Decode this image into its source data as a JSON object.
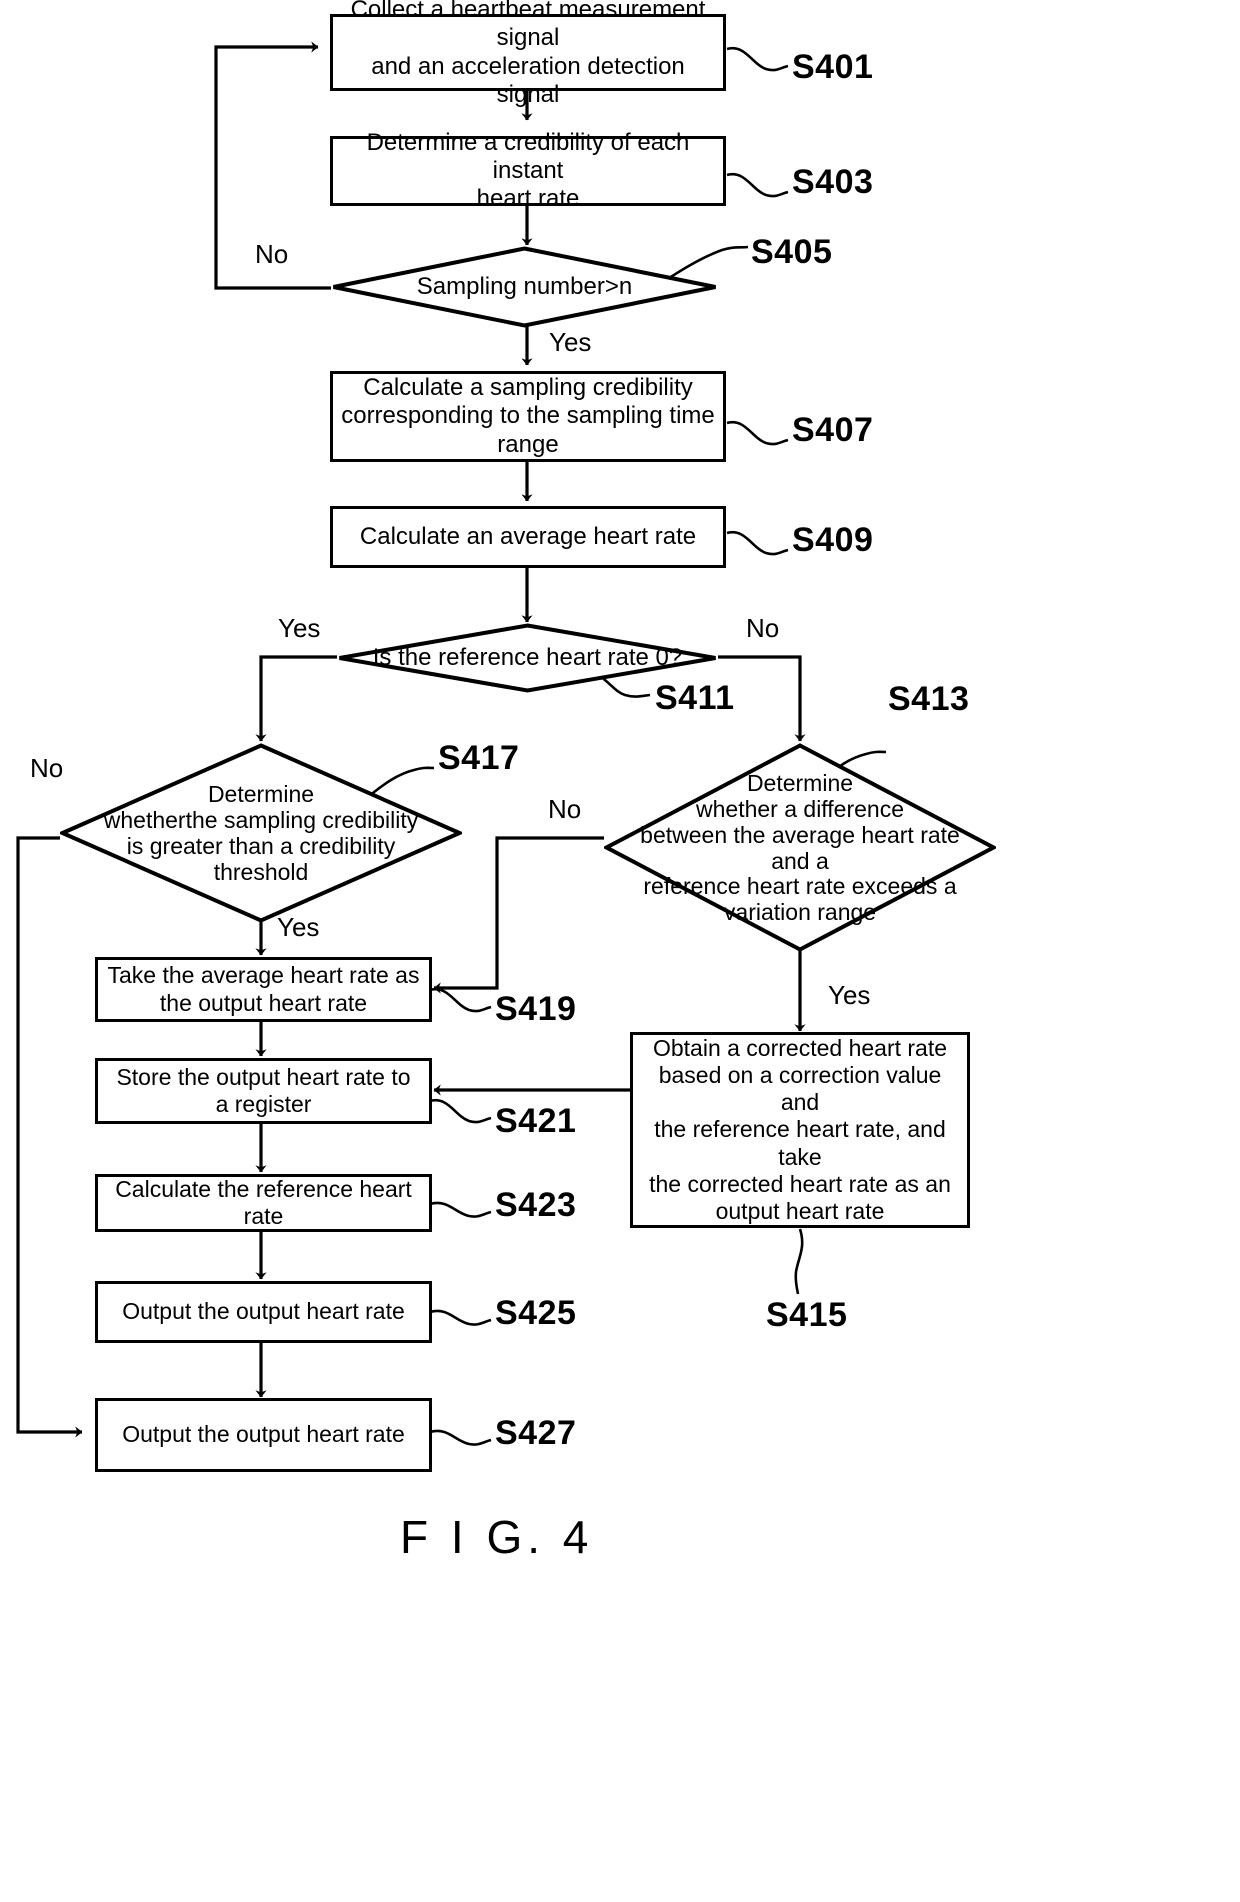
{
  "figure": {
    "caption": "F I G.  4",
    "caption_plain": "FIG. 4"
  },
  "nodes": {
    "s401": {
      "id": "S401",
      "type": "process",
      "line1": "Collect a heartbeat measurement signal",
      "line2": "and an acceleration detection signal"
    },
    "s403": {
      "id": "S403",
      "type": "process",
      "line1": "Determine a credibility of each instant",
      "line2": "heart rate"
    },
    "s405": {
      "id": "S405",
      "type": "decision",
      "line1": "Sampling number>n"
    },
    "s407": {
      "id": "S407",
      "type": "process",
      "line1": "Calculate a sampling credibility",
      "line2": "corresponding to the sampling time range"
    },
    "s409": {
      "id": "S409",
      "type": "process",
      "line1": "Calculate an average heart rate"
    },
    "s411": {
      "id": "S411",
      "type": "decision",
      "line1": "Is the reference heart rate 0?"
    },
    "s413": {
      "id": "S413",
      "type": "decision",
      "line1": "Determine",
      "line2": "whether a difference",
      "line3": "between the average heart rate and a",
      "line4": "reference heart rate exceeds a",
      "line5": "variation range"
    },
    "s415": {
      "id": "S415",
      "type": "process",
      "line1": "Obtain a corrected heart rate",
      "line2": "based on a correction value and",
      "line3": "the reference heart rate, and take",
      "line4": "the corrected heart rate as an",
      "line5": "output heart rate"
    },
    "s417": {
      "id": "S417",
      "type": "decision",
      "line1": "Determine",
      "line2": "whetherthe sampling credibility",
      "line3": "is greater than a credibility",
      "line4": "threshold"
    },
    "s419": {
      "id": "S419",
      "type": "process",
      "line1": "Take the average heart rate as",
      "line2": "the output heart rate"
    },
    "s421": {
      "id": "S421",
      "type": "process",
      "line1": "Store the output heart rate to",
      "line2": "a register"
    },
    "s423": {
      "id": "S423",
      "type": "process",
      "line1": "Calculate the reference heart rate"
    },
    "s425": {
      "id": "S425",
      "type": "process",
      "line1": "Output the output heart rate"
    },
    "s427": {
      "id": "S427",
      "type": "process",
      "line1": "Output the output heart rate"
    }
  },
  "edge_labels": {
    "s405_no": "No",
    "s405_yes": "Yes",
    "s411_yes": "Yes",
    "s411_no": "No",
    "s413_no": "No",
    "s413_yes": "Yes",
    "s417_no": "No",
    "s417_yes": "Yes"
  },
  "style": {
    "ink": "#000000",
    "paper": "#ffffff"
  }
}
